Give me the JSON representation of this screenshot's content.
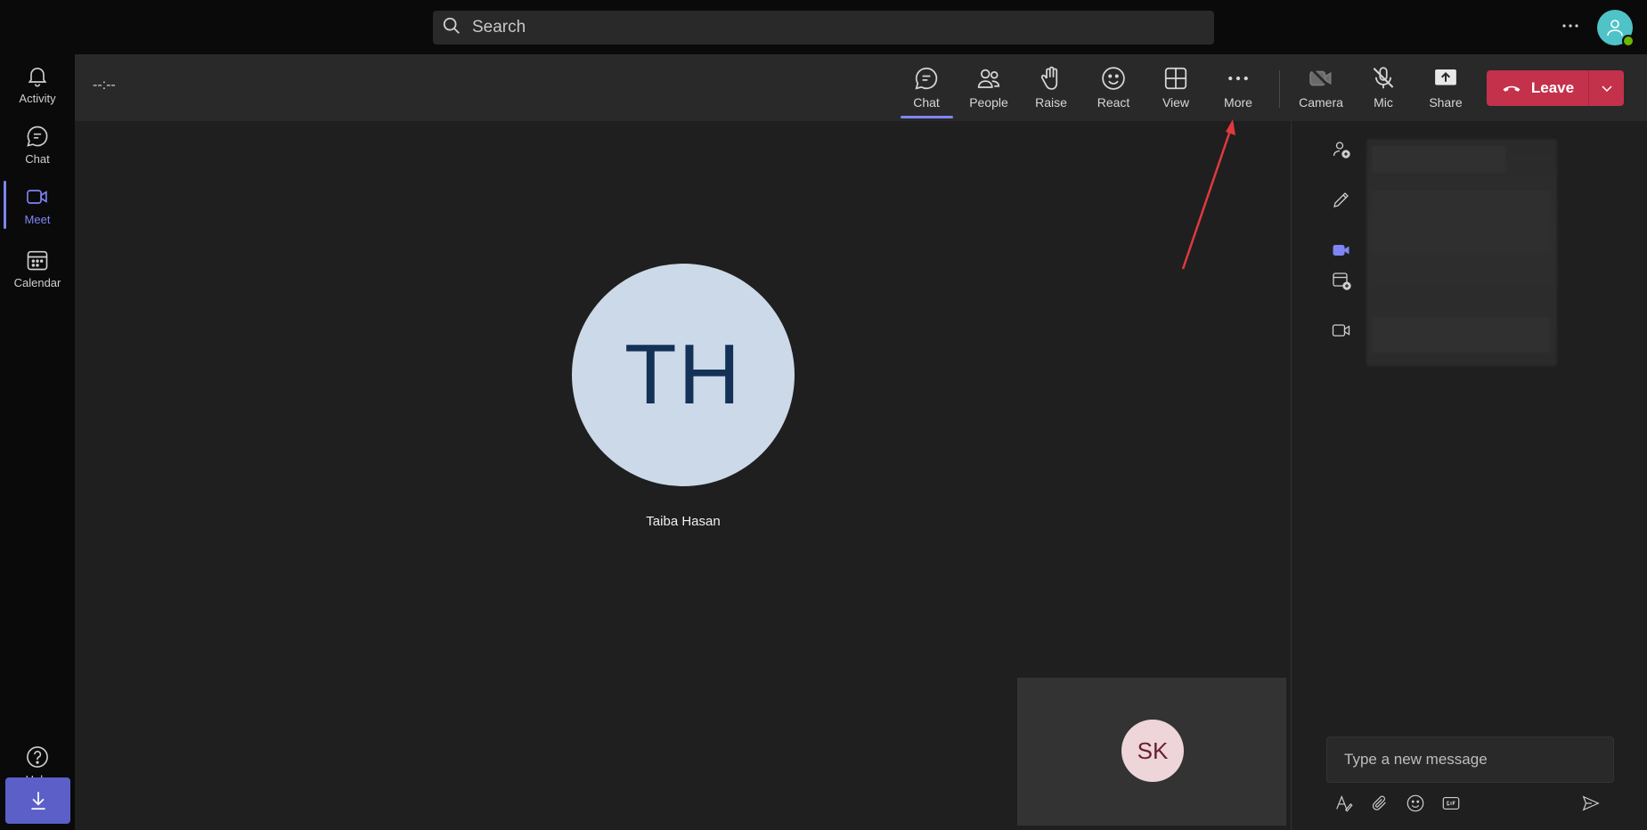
{
  "search": {
    "placeholder": "Search"
  },
  "topbar": {
    "more_icon": "more-horizontal-icon",
    "avatar_icon": "person-icon",
    "presence_color": "#6bb700"
  },
  "rail": {
    "items": [
      {
        "label": "Activity",
        "icon": "bell-icon"
      },
      {
        "label": "Chat",
        "icon": "chat-icon"
      },
      {
        "label": "Meet",
        "icon": "video-icon",
        "active": true
      },
      {
        "label": "Calendar",
        "icon": "calendar-icon"
      },
      {
        "label": "Help",
        "icon": "help-icon"
      }
    ],
    "download_icon": "download-icon"
  },
  "meeting": {
    "timer": "--:--",
    "controls": [
      {
        "label": "Chat",
        "icon": "chat-icon",
        "selected": true
      },
      {
        "label": "People",
        "icon": "people-icon"
      },
      {
        "label": "Raise",
        "icon": "hand-icon"
      },
      {
        "label": "React",
        "icon": "smile-icon"
      },
      {
        "label": "View",
        "icon": "grid-icon"
      },
      {
        "label": "More",
        "icon": "more-horizontal-icon"
      },
      {
        "label": "Camera",
        "icon": "camera-off-icon"
      },
      {
        "label": "Mic",
        "icon": "mic-off-icon"
      },
      {
        "label": "Share",
        "icon": "share-icon"
      }
    ],
    "leave_label": "Leave",
    "leave_color": "#c4314b"
  },
  "stage": {
    "main_participant": {
      "initials": "TH",
      "name": "Taiba Hasan"
    },
    "self_participant": {
      "initials": "SK"
    }
  },
  "panel": {
    "side_icons": [
      "add-person-icon",
      "pencil-icon",
      "video-icon",
      "calendar-add-icon",
      "camera-icon"
    ],
    "compose_placeholder": "Type a new message",
    "compose_tools": [
      "format-icon",
      "attach-icon",
      "emoji-icon",
      "gif-icon",
      "send-icon"
    ]
  },
  "accent": "#7f85f5"
}
